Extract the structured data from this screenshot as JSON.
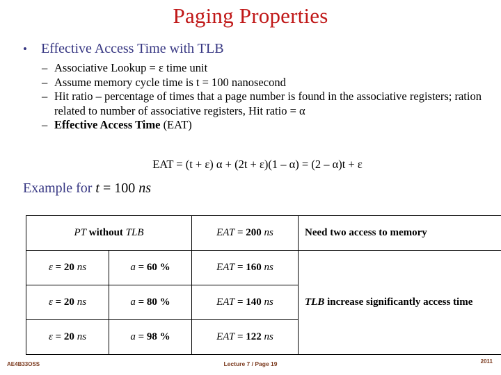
{
  "slide": {
    "title": "Paging Properties",
    "title_color": "#C01818",
    "accent_color": "#363682",
    "footer_color": "#7B3A1E"
  },
  "bullet": {
    "glyph": "bullet-dot",
    "marker": "•",
    "text": "Effective Access Time with TLB"
  },
  "sub_bullets": {
    "dash": "–",
    "items": [
      {
        "text": "Associative Lookup = ε time unit"
      },
      {
        "text": "Assume memory cycle time is t = 100 nanosecond"
      },
      {
        "text": "Hit ratio – percentage of times that a page number is found in the associative registers; ration related to number of associative registers, Hit ratio = α"
      },
      {
        "bold": "Effective Access Time",
        "rest": " (EAT)"
      }
    ]
  },
  "formula": {
    "text": "EAT = (t + ε) α + (2t + ε)(1 – α) = (2 – α)t  + ε"
  },
  "example_heading": {
    "prefix": "Example for ",
    "var_t": "t",
    "equals_value": " = 100 ",
    "unit": "ns"
  },
  "table": {
    "header": {
      "label_pt": "PT",
      "label_without": " without ",
      "label_tlb": "TLB",
      "eat": {
        "sym": "EAT",
        "rest": " = 200 ",
        "unit": "ns"
      },
      "note": "Need two access to memory"
    },
    "rows": [
      {
        "epsilon": {
          "sym": "ε",
          "rest": " = 20 ",
          "unit": "ns"
        },
        "alpha": {
          "sym": "a",
          "rest": " = 60 %"
        },
        "eat": {
          "sym": "EAT",
          "rest": " = 160 ",
          "unit": "ns"
        }
      },
      {
        "epsilon": {
          "sym": "ε",
          "rest": " = 20 ",
          "unit": "ns"
        },
        "alpha": {
          "sym": "a",
          "rest": " = 80 %"
        },
        "eat": {
          "sym": "EAT",
          "rest": " = 140 ",
          "unit": "ns"
        }
      },
      {
        "epsilon": {
          "sym": "ε",
          "rest": " = 20 ",
          "unit": "ns"
        },
        "alpha": {
          "sym": "a",
          "rest": " = 98 %"
        },
        "eat": {
          "sym": "EAT",
          "rest": " = 122 ",
          "unit": "ns"
        }
      }
    ],
    "merged_note": {
      "sym": "TLB",
      "rest": " increase significantly access time"
    }
  },
  "footer": {
    "left": "AE4B33OSS",
    "center": "Lecture 7 / Page 19",
    "right": "2011"
  }
}
